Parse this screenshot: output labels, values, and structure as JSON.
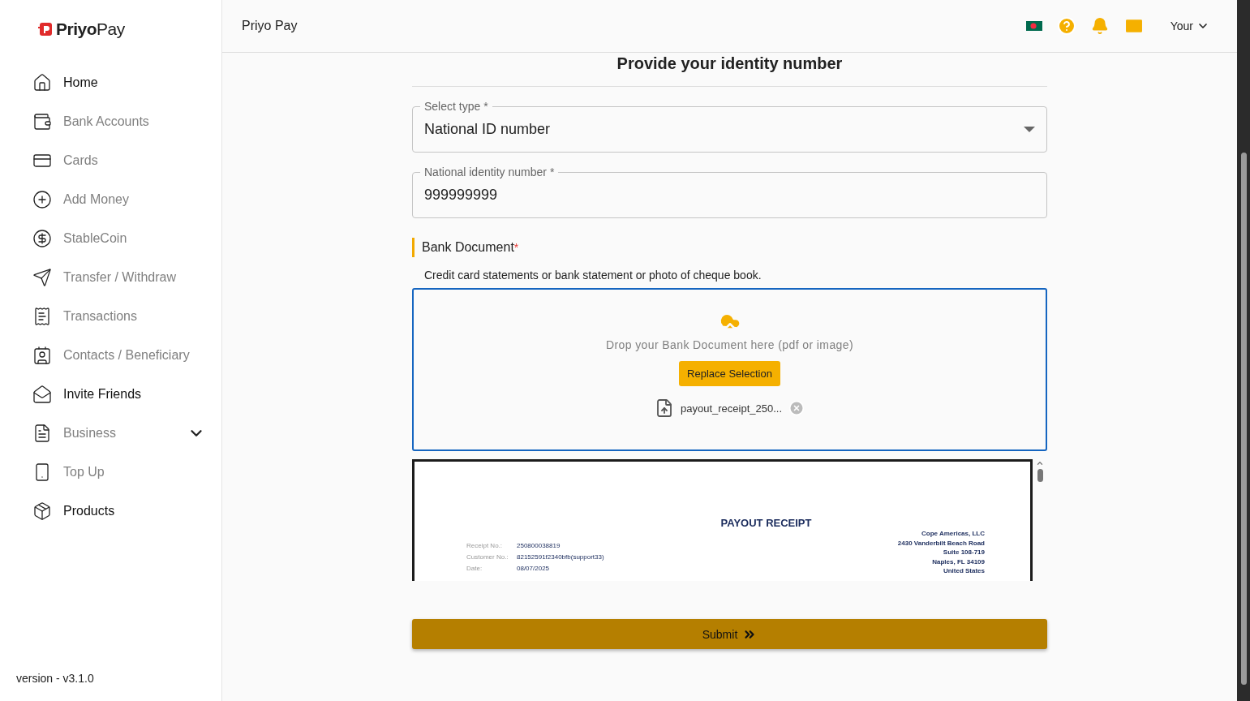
{
  "brand": {
    "name_bold": "Priyo",
    "name_light": "Pay"
  },
  "sidebar": {
    "items": [
      {
        "label": "Home",
        "kind": "home",
        "disabled": false,
        "expandable": false
      },
      {
        "label": "Bank Accounts",
        "kind": "bank",
        "disabled": true,
        "expandable": false
      },
      {
        "label": "Cards",
        "kind": "cards",
        "disabled": true,
        "expandable": false
      },
      {
        "label": "Add Money",
        "kind": "add",
        "disabled": true,
        "expandable": false
      },
      {
        "label": "StableCoin",
        "kind": "coin",
        "disabled": true,
        "expandable": false
      },
      {
        "label": "Transfer / Withdraw",
        "kind": "send",
        "disabled": true,
        "expandable": false
      },
      {
        "label": "Transactions",
        "kind": "receipt",
        "disabled": true,
        "expandable": false
      },
      {
        "label": "Contacts / Beneficiary",
        "kind": "contacts",
        "disabled": true,
        "expandable": false
      },
      {
        "label": "Invite Friends",
        "kind": "invite",
        "disabled": false,
        "expandable": false
      },
      {
        "label": "Business",
        "kind": "business",
        "disabled": true,
        "expandable": true
      },
      {
        "label": "Top Up",
        "kind": "topup",
        "disabled": true,
        "expandable": false
      },
      {
        "label": "Products",
        "kind": "products",
        "disabled": false,
        "expandable": false
      }
    ],
    "version": "version - v3.1.0"
  },
  "header": {
    "title": "Priyo Pay",
    "user": "Your"
  },
  "form": {
    "heading": "Provide your identity number",
    "select": {
      "label": "Select type",
      "required_mark": "*",
      "value": "National ID number"
    },
    "id_field": {
      "label": "National identity number",
      "required_mark": "*",
      "value": "999999999"
    },
    "document": {
      "title": "Bank Document",
      "required_mark": "*",
      "hint": "Credit card statements or bank statement or photo of cheque book.",
      "drop_text": "Drop your Bank Document here (pdf or image)",
      "replace_button": "Replace Selection",
      "file_name": "payout_receipt_250..."
    },
    "preview": {
      "title": "PAYOUT RECEIPT",
      "fields": [
        {
          "label": "Receipt No.:",
          "value": "250800038819"
        },
        {
          "label": "Customer No.:",
          "value": "82152591f2340bfb(support33)"
        },
        {
          "label": "Date:",
          "value": "08/07/2025"
        }
      ],
      "address": [
        "Cope Americas, LLC",
        "2430 Vanderbilt Beach Road",
        "Suite 108-719",
        "Naples, FL 34109",
        "United States"
      ]
    },
    "submit": "Submit"
  }
}
